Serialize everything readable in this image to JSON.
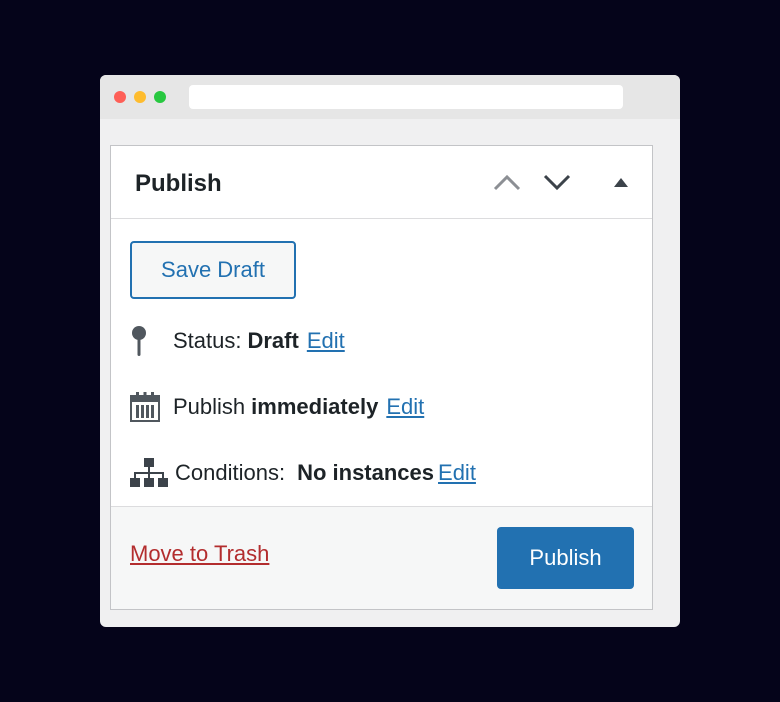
{
  "panel": {
    "title": "Publish",
    "controls": [
      "move-up",
      "move-down",
      "toggle-panel"
    ]
  },
  "actions": {
    "save_draft_label": "Save Draft",
    "publish_label": "Publish",
    "trash_label": "Move to Trash"
  },
  "status": {
    "label": "Status:",
    "value": "Draft",
    "edit_label": "Edit",
    "icon": "pin-icon"
  },
  "schedule": {
    "label": "Publish",
    "value": "immediately",
    "edit_label": "Edit",
    "icon": "calendar-icon"
  },
  "conditions": {
    "label": "Conditions:",
    "value": "No instances",
    "edit_label": "Edit",
    "icon": "sitemap-icon"
  },
  "colors": {
    "accent": "#2271b1",
    "danger": "#b32d2e",
    "text": "#1d2327",
    "background": "#05041a"
  }
}
